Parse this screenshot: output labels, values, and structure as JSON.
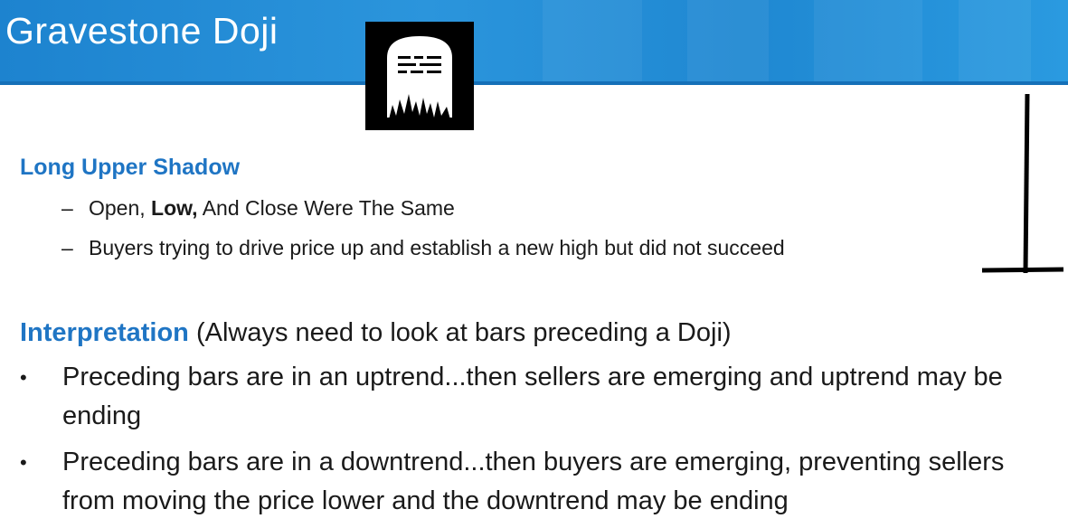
{
  "header": {
    "title": "Gravestone Doji"
  },
  "section1": {
    "heading": "Long Upper Shadow",
    "items": [
      {
        "dash": "–",
        "pre": "Open, ",
        "bold": "Low,",
        "post": " And Close Were The Same"
      },
      {
        "dash": "–",
        "text": "Buyers trying to drive price up and establish a new high but did not succeed"
      }
    ]
  },
  "section2": {
    "heading": "Interpretation",
    "note": " (Always need to look at bars preceding a Doji)",
    "bullets": [
      {
        "marker": "•",
        "text": "Preceding bars are in an uptrend...then sellers are emerging and uptrend may be ending"
      },
      {
        "marker": "•",
        "text": "Preceding bars are in a downtrend...then buyers are emerging, preventing sellers from moving the price lower and the downtrend may be ending"
      }
    ]
  },
  "icons": {
    "gravestone": "gravestone-icon",
    "doji": "gravestone-doji-candle-icon"
  },
  "colors": {
    "header_blue": "#1d83cf",
    "heading_blue": "#1f75c4",
    "text": "#1a1a1a"
  }
}
